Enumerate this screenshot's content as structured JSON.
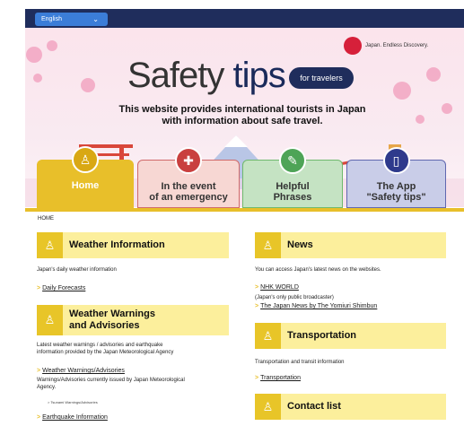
{
  "language": {
    "selected": "English"
  },
  "header": {
    "logo_text": "Japan. Endless Discovery.",
    "brand_word1": "Safety",
    "brand_word2": "tips",
    "brand_pill": "for travelers",
    "lead_line1": "This website provides international tourists in Japan",
    "lead_line2": "with information about safe travel."
  },
  "tabs": [
    {
      "label": "Home"
    },
    {
      "label_line1": "In the event",
      "label_line2": "of an emergency"
    },
    {
      "label_line1": "Helpful",
      "label_line2": "Phrases"
    },
    {
      "label_line1": "The App",
      "label_line2": "\"Safety tips\""
    }
  ],
  "breadcrumb": "HOME",
  "left": {
    "weather": {
      "title": "Weather Information",
      "desc": "Japan's daily weather information",
      "link": "Daily Forecasts"
    },
    "warnings": {
      "title_line1": "Weather Warnings",
      "title_line2": "and Advisories",
      "desc_line1": "Latest weather warnings / advisories and earthquake",
      "desc_line2": "information provided by the Japan Meteorological Agency",
      "link1": "Weather Warnings/Advisories",
      "link1_desc_line1": "Warnings/Advisories currently issued by Japan Meteorological",
      "link1_desc_line2": "Agency.",
      "sublink": "Tsunami Warnings/Advisories",
      "link2": "Earthquake Information"
    }
  },
  "right": {
    "news": {
      "title": "News",
      "desc": "You can access Japan's latest news on the websites.",
      "link1": "NHK WORLD",
      "link1_note": "(Japan's only public broadcaster)",
      "link2": "The Japan News by The Yomiuri Shimbun"
    },
    "transport": {
      "title": "Transportation",
      "desc": "Transportation and transit information",
      "link": "Transportation"
    },
    "contact": {
      "title": "Contact list"
    }
  },
  "colors": {
    "navy": "#1f2d5c",
    "yellow": "#e8bf2a",
    "section_bg": "#fcef9c"
  }
}
